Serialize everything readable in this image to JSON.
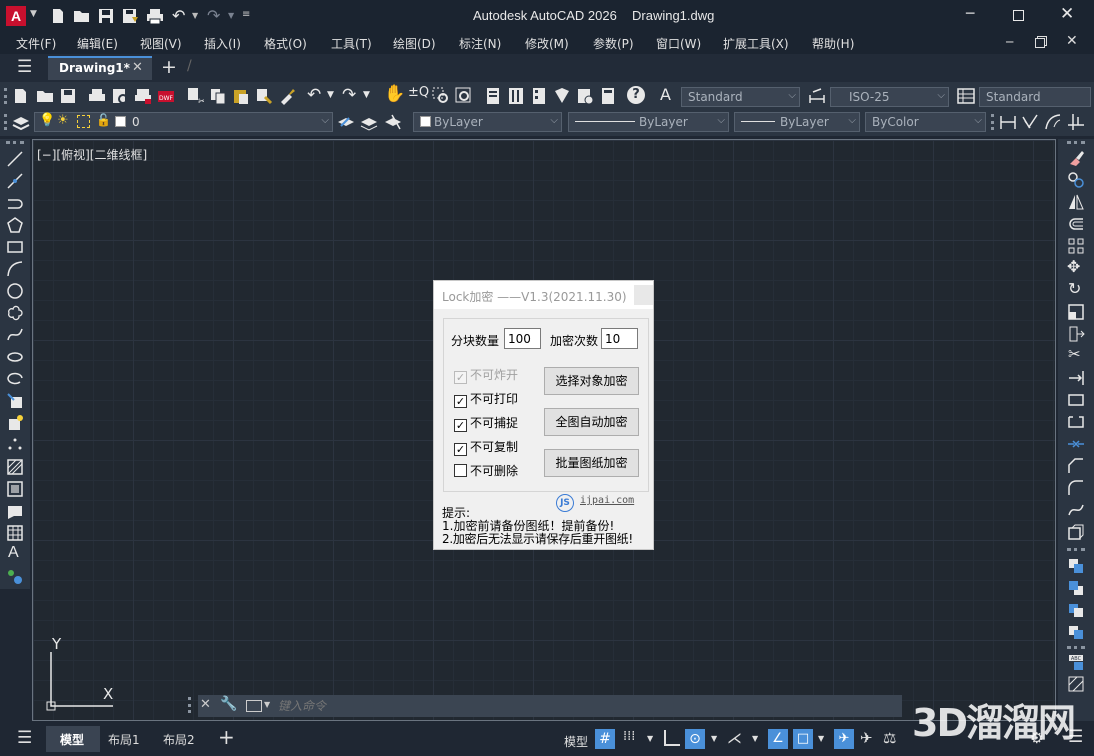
{
  "titlebar": {
    "app_title": "Autodesk AutoCAD 2026",
    "doc_title": "Drawing1.dwg",
    "logo_letter": "A"
  },
  "menu": [
    "文件(F)",
    "编辑(E)",
    "视图(V)",
    "插入(I)",
    "格式(O)",
    "工具(T)",
    "绘图(D)",
    "标注(N)",
    "修改(M)",
    "参数(P)",
    "窗口(W)",
    "扩展工具(X)",
    "帮助(H)"
  ],
  "tabs": {
    "active": "Drawing1*"
  },
  "toolbar1": {
    "text_style": "Standard",
    "dim_style": "ISO-25",
    "table_style": "Standard"
  },
  "toolbar2": {
    "layer": "0",
    "color": "ByLayer",
    "linetype": "ByLayer",
    "lineweight": "ByLayer",
    "plotstyle": "ByColor"
  },
  "viewport": {
    "label": "[−][俯视][二维线框]"
  },
  "ucs": {
    "x": "X",
    "y": "Y"
  },
  "dialog": {
    "title": "Lock加密 ——V1.3(2021.11.30)",
    "block_count_label": "分块数量",
    "block_count_value": "100",
    "encrypt_times_label": "加密次数",
    "encrypt_times_value": "10",
    "checkboxes": [
      {
        "label": "不可炸开",
        "checked": "✓",
        "enabled": false
      },
      {
        "label": "不可打印",
        "checked": "✓",
        "enabled": true
      },
      {
        "label": "不可捕捉",
        "checked": "✓",
        "enabled": true
      },
      {
        "label": "不可复制",
        "checked": "✓",
        "enabled": true
      },
      {
        "label": "不可删除",
        "checked": "",
        "enabled": true
      }
    ],
    "buttons": [
      "选择对象加密",
      "全图自动加密",
      "批量图纸加密"
    ],
    "site_logo": "JS",
    "site": "ijpai.com",
    "hint_title": "提示:",
    "hint_1": "1.加密前请备份图纸！提前备份!",
    "hint_2": "2.加密后无法显示请保存后重开图纸!"
  },
  "cmdline": {
    "placeholder": "键入命令"
  },
  "status": {
    "tab_model": "模型",
    "tab_layout1": "布局1",
    "tab_layout2": "布局2",
    "model_label": "模型",
    "watermark": "3D溜溜网"
  }
}
